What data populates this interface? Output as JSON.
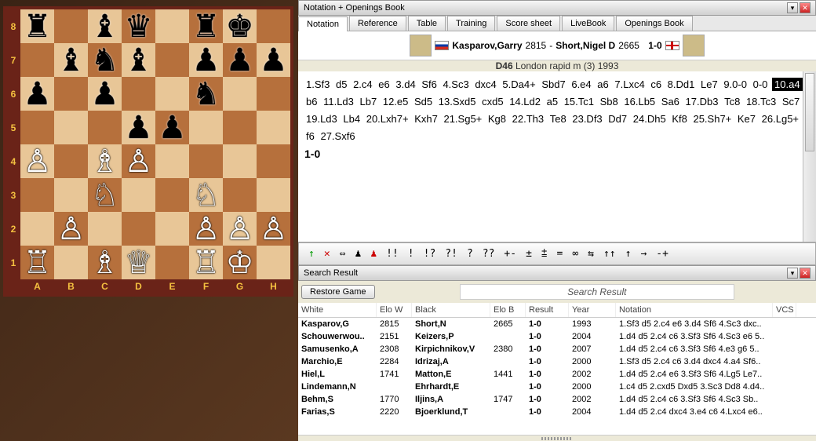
{
  "panes": {
    "notation_title": "Notation + Openings Book",
    "search_title": "Search Result"
  },
  "tabs": [
    "Notation",
    "Reference",
    "Table",
    "Training",
    "Score sheet",
    "LiveBook",
    "Openings Book"
  ],
  "active_tab": 0,
  "game_header": {
    "white_name": "Kasparov,Garry",
    "white_elo": "2815",
    "sep": "-",
    "black_name": "Short,Nigel D",
    "black_elo": "2665",
    "result": "1-0",
    "eco": "D46",
    "event": "London rapid m (3) 1993"
  },
  "notation_moves": [
    "1.Sf3",
    "d5",
    "2.c4",
    "e6",
    "3.d4",
    "Sf6",
    "4.Sc3",
    "dxc4",
    "5.Da4+",
    "Sbd7",
    "6.e4",
    "a6",
    "7.Lxc4",
    "c6",
    "8.Dd1",
    "Le7",
    "9.0-0",
    "0-0",
    "10.a4",
    "b6",
    "11.Ld3",
    "Lb7",
    "12.e5",
    "Sd5",
    "13.Sxd5",
    "cxd5",
    "14.Ld2",
    "a5",
    "15.Tc1",
    "Sb8",
    "16.Lb5",
    "Sa6",
    "17.Db3",
    "Tc8",
    "18.Tc3",
    "Sc7",
    "19.Ld3",
    "Lb4",
    "20.Lxh7+",
    "Kxh7",
    "21.Sg5+",
    "Kg8",
    "22.Th3",
    "Te8",
    "23.Df3",
    "Dd7",
    "24.Dh5",
    "Kf8",
    "25.Sh7+",
    "Ke7",
    "26.Lg5+",
    "f6",
    "27.Sxf6"
  ],
  "current_move_index": 18,
  "final_result": "1-0",
  "toolbar": {
    "items": [
      "↑",
      "✕",
      "⇔",
      "♟",
      "♟",
      "!!",
      "!",
      "!?",
      "?!",
      "?",
      "??",
      "+-",
      "±",
      "⩲",
      "=",
      "∞",
      "⇆",
      "↑↑",
      "↑",
      "→",
      "-+"
    ],
    "red_indices": [
      1,
      4
    ]
  },
  "search": {
    "restore_btn": "Restore Game",
    "label": "Search Result",
    "columns": [
      "White",
      "Elo W",
      "Black",
      "Elo B",
      "Result",
      "Year",
      "Notation",
      "VCS"
    ],
    "rows": [
      {
        "w": "Kasparov,G",
        "ew": "2815",
        "b": "Short,N",
        "eb": "2665",
        "r": "1-0",
        "y": "1993",
        "n": "1.Sf3 d5 2.c4 e6 3.d4 Sf6 4.Sc3 dxc.."
      },
      {
        "w": "Schouwerwou..",
        "ew": "2151",
        "b": "Keizers,P",
        "eb": "",
        "r": "1-0",
        "y": "2004",
        "n": "1.d4 d5 2.c4 c6 3.Sf3 Sf6 4.Sc3 e6 5.."
      },
      {
        "w": "Samusenko,A",
        "ew": "2308",
        "b": "Kirpichnikov,V",
        "eb": "2380",
        "r": "1-0",
        "y": "2007",
        "n": "1.d4 d5 2.c4 c6 3.Sf3 Sf6 4.e3 g6 5.."
      },
      {
        "w": "Marchio,E",
        "ew": "2284",
        "b": "Idrizaj,A",
        "eb": "",
        "r": "1-0",
        "y": "2000",
        "n": "1.Sf3 d5 2.c4 c6 3.d4 dxc4 4.a4 Sf6.."
      },
      {
        "w": "Hiel,L",
        "ew": "1741",
        "b": "Matton,E",
        "eb": "1441",
        "r": "1-0",
        "y": "2002",
        "n": "1.d4 d5 2.c4 e6 3.Sf3 Sf6 4.Lg5 Le7.."
      },
      {
        "w": "Lindemann,N",
        "ew": "",
        "b": "Ehrhardt,E",
        "eb": "",
        "r": "1-0",
        "y": "2000",
        "n": "1.c4 d5 2.cxd5 Dxd5 3.Sc3 Dd8 4.d4.."
      },
      {
        "w": "Behm,S",
        "ew": "1770",
        "b": "Iljins,A",
        "eb": "1747",
        "r": "1-0",
        "y": "2002",
        "n": "1.d4 d5 2.c4 c6 3.Sf3 Sf6 4.Sc3 Sb.."
      },
      {
        "w": "Farias,S",
        "ew": "2220",
        "b": "Bjoerklund,T",
        "eb": "",
        "r": "1-0",
        "y": "2004",
        "n": "1.d4 d5 2.c4 dxc4 3.e4 c6 4.Lxc4 e6.."
      }
    ]
  },
  "board": {
    "white_to_move_marker": false,
    "position": [
      [
        "r",
        ".",
        "b",
        "q",
        ".",
        "r",
        "k",
        "."
      ],
      [
        ".",
        "l",
        "n",
        "b",
        ".",
        "p",
        "p",
        "p"
      ],
      [
        "p",
        ".",
        "p",
        ".",
        ".",
        "n",
        ".",
        "."
      ],
      [
        ".",
        ".",
        ".",
        "p",
        "p",
        ".",
        ".",
        "."
      ],
      [
        "P",
        ".",
        "B",
        "P",
        ".",
        ".",
        ".",
        "."
      ],
      [
        ".",
        ".",
        "N",
        ".",
        ".",
        "N",
        ".",
        "."
      ],
      [
        ".",
        "P",
        ".",
        ".",
        ".",
        "P",
        "P",
        "P"
      ],
      [
        "R",
        ".",
        "B",
        "Q",
        ".",
        "R",
        "K",
        "."
      ]
    ]
  },
  "board_labels": {
    "ranks": [
      "8",
      "7",
      "6",
      "5",
      "4",
      "3",
      "2",
      "1"
    ],
    "files": [
      "A",
      "B",
      "C",
      "D",
      "E",
      "F",
      "G",
      "H"
    ]
  }
}
